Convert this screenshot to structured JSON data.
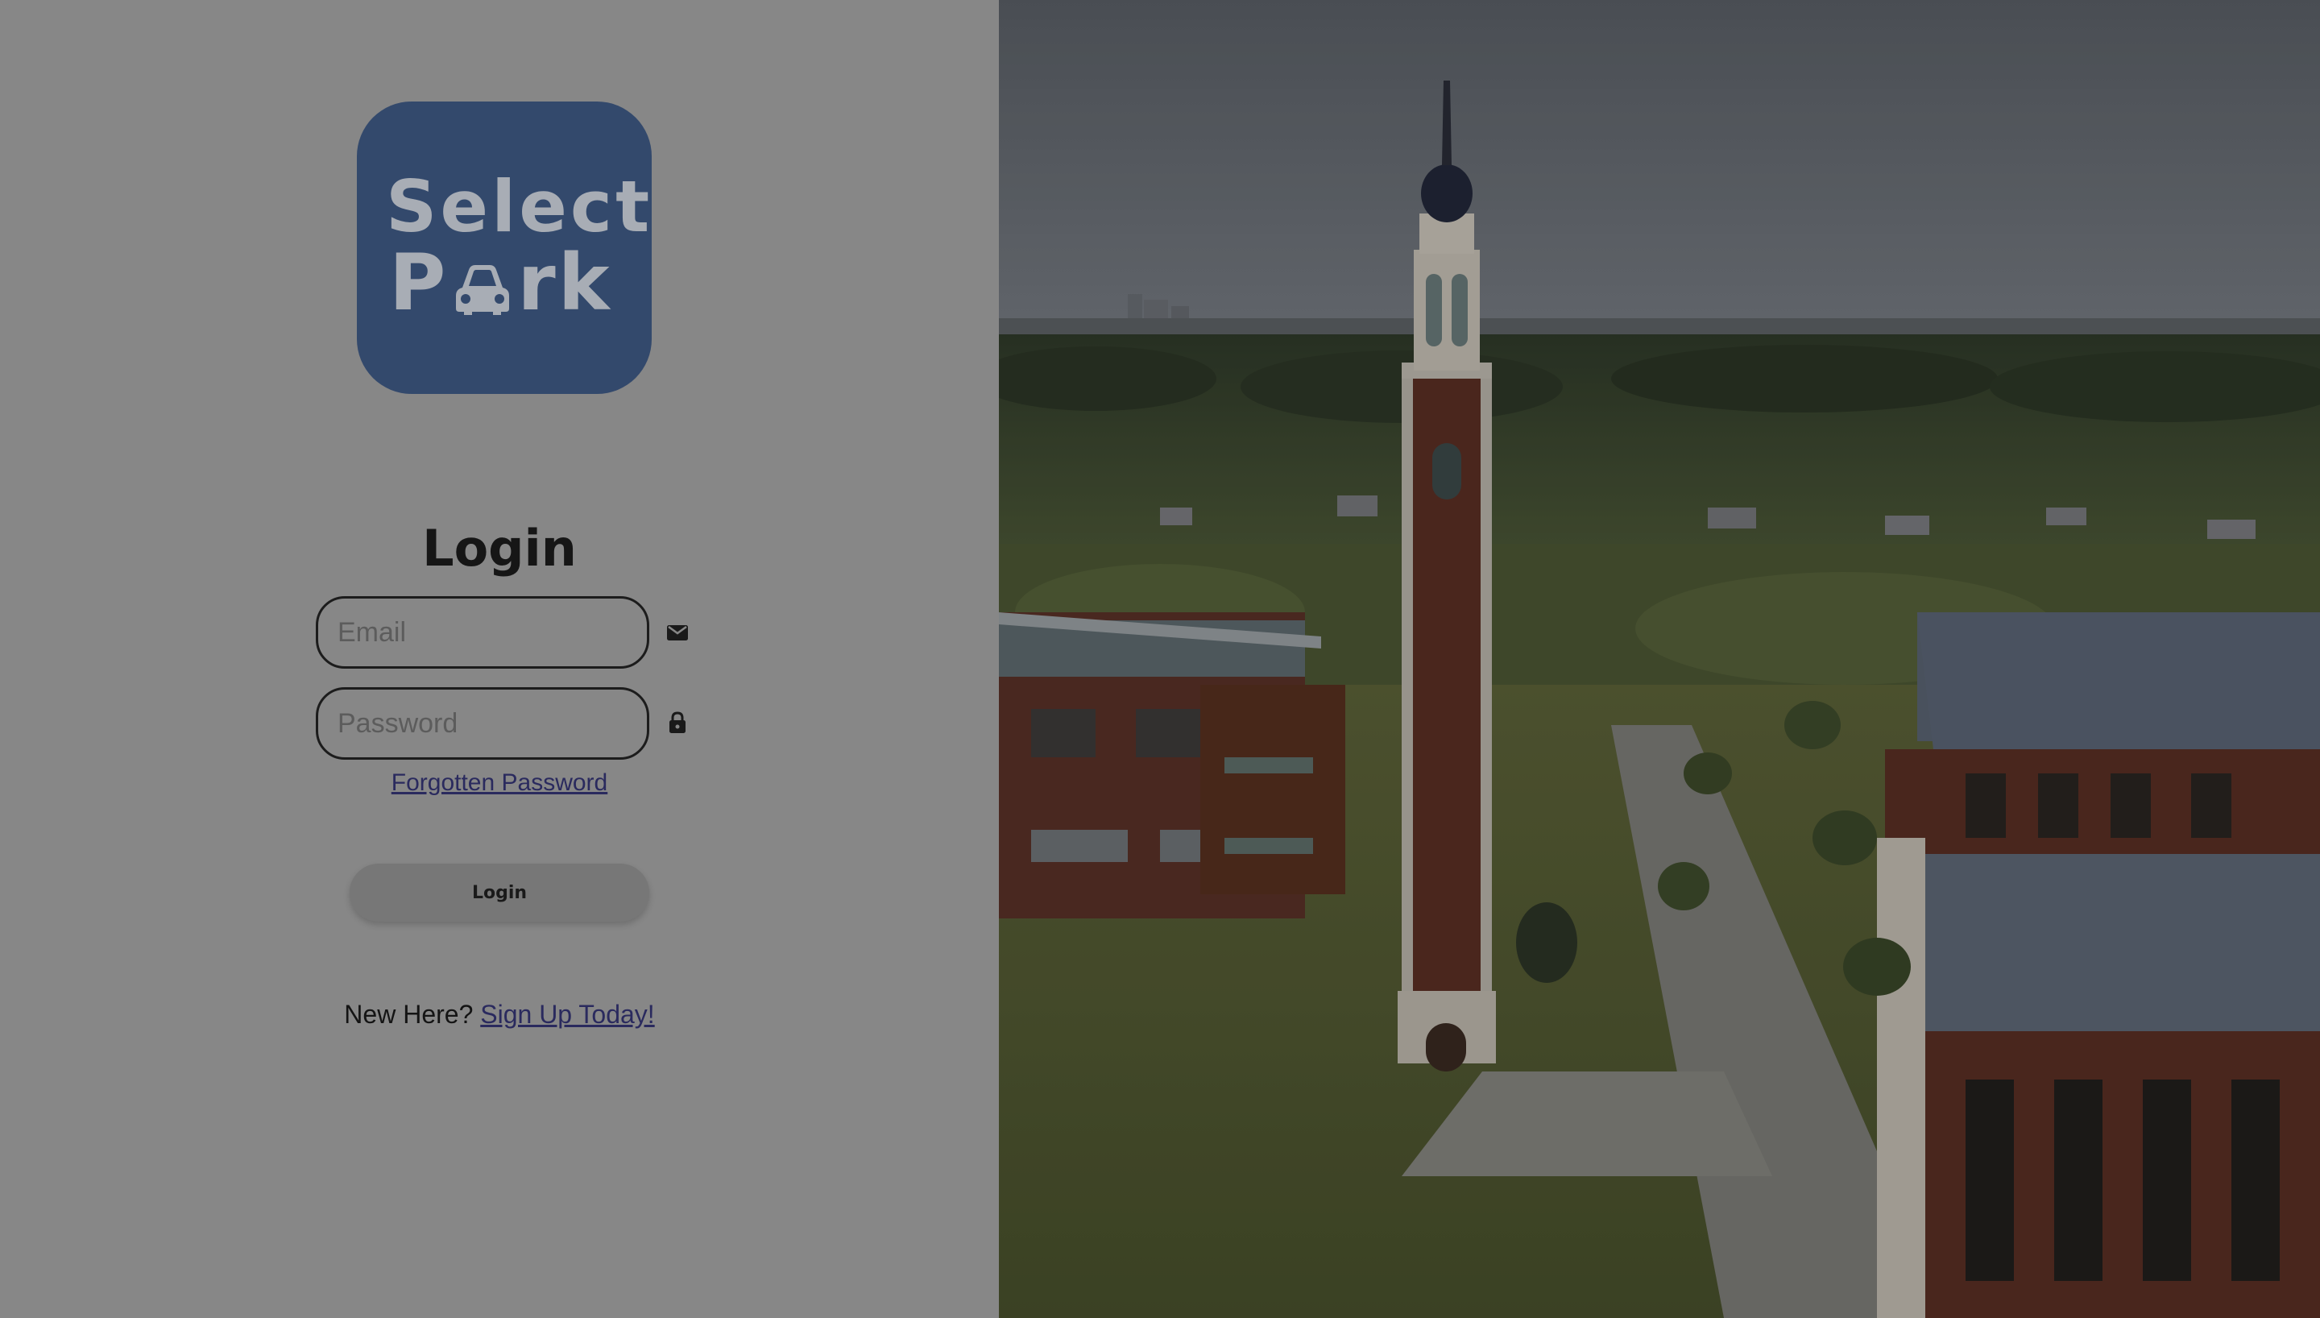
{
  "logo": {
    "line1": "Select",
    "line2_start": "P",
    "line2_end": "rk",
    "bg_color": "#33496c"
  },
  "form": {
    "title": "Login",
    "email_placeholder": "Email",
    "password_placeholder": "Password",
    "forgot_label": "Forgotten Password",
    "login_button": "Login"
  },
  "signup": {
    "prompt": "New Here?",
    "link": "Sign Up Today!"
  },
  "icons": {
    "email": "mail-icon",
    "password": "lock-icon"
  },
  "background": {
    "subject": "campus-clock-tower-photo"
  }
}
